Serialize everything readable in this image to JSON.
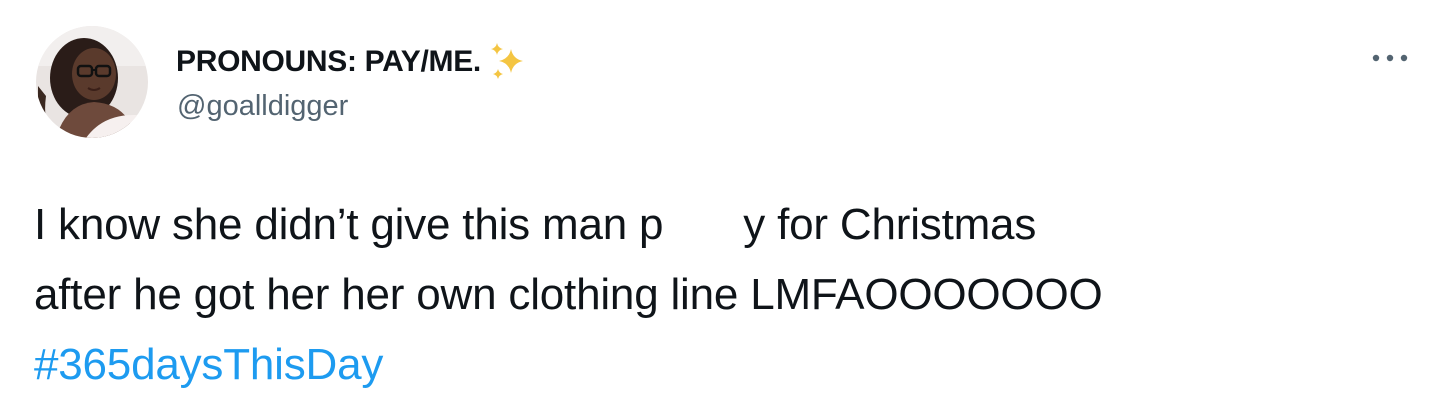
{
  "tweet": {
    "display_name": "PRONOUNS: PAY/ME.",
    "name_emoji_icon": "sparkles-icon",
    "handle": "@goalldigger",
    "more_icon": "more-dots-icon",
    "text": {
      "line1_part1": "I know she didn’t give this man p",
      "line1_part2": "y for Christmas",
      "line2": "after he got her her own clothing line LMFAOOOOOOO",
      "hashtag": "#365daysThisDay"
    }
  },
  "colors": {
    "text_primary": "#0f1419",
    "text_secondary": "#536471",
    "link": "#1d9bf0",
    "sparkle": "#f4c542"
  }
}
